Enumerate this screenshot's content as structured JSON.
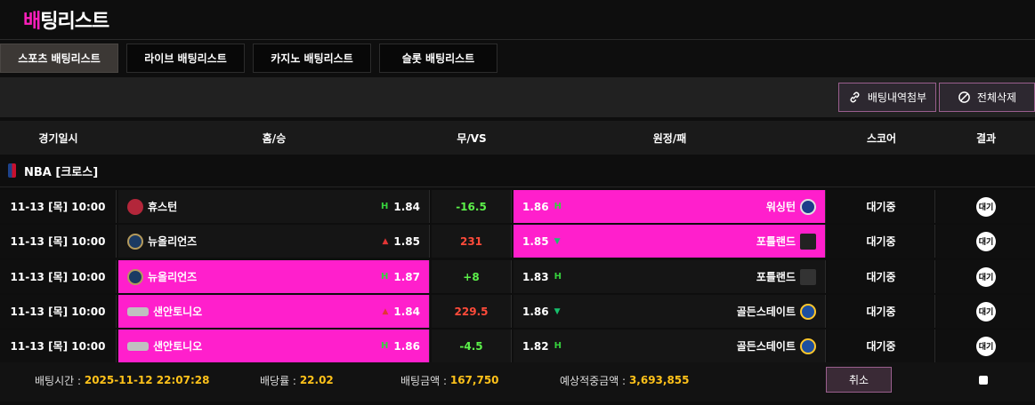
{
  "page": {
    "title_accent": "배",
    "title_rest": "팅리스트"
  },
  "tabs": [
    {
      "label": "스포츠 배팅리스트",
      "active": true
    },
    {
      "label": "라이브 배팅리스트",
      "active": false
    },
    {
      "label": "카지노 배팅리스트",
      "active": false
    },
    {
      "label": "슬롯 배팅리스트",
      "active": false
    }
  ],
  "toolbar": {
    "attach_label": "배팅내역첨부",
    "delete_all_label": "전체삭제"
  },
  "columns": {
    "date": "경기일시",
    "home": "홈/승",
    "draw": "무/VS",
    "away": "원정/패",
    "score": "스코어",
    "result": "결과"
  },
  "league": {
    "name": "NBA [크로스]"
  },
  "rows": [
    {
      "date": "11-13 [목] 10:00",
      "home_team": "휴스턴",
      "home_odds": "1.84",
      "draw": "-16.5",
      "away_team": "워싱턴",
      "away_odds": "1.86",
      "score": "대기중",
      "result": "대기"
    },
    {
      "date": "11-13 [목] 10:00",
      "home_team": "뉴올리언즈",
      "home_odds": "1.85",
      "draw": "231",
      "away_team": "포틀랜드",
      "away_odds": "1.85",
      "score": "대기중",
      "result": "대기"
    },
    {
      "date": "11-13 [목] 10:00",
      "home_team": "뉴올리언즈",
      "home_odds": "1.87",
      "draw": "+8",
      "away_team": "포틀랜드",
      "away_odds": "1.83",
      "score": "대기중",
      "result": "대기"
    },
    {
      "date": "11-13 [목] 10:00",
      "home_team": "샌안토니오",
      "home_odds": "1.84",
      "draw": "229.5",
      "away_team": "골든스테이트",
      "away_odds": "1.86",
      "score": "대기중",
      "result": "대기"
    },
    {
      "date": "11-13 [목] 10:00",
      "home_team": "샌안토니오",
      "home_odds": "1.86",
      "draw": "-4.5",
      "away_team": "골든스테이트",
      "away_odds": "1.82",
      "score": "대기중",
      "result": "대기"
    }
  ],
  "footer": {
    "bet_time_label": "배팅시간 :",
    "bet_time": "2025-11-12 22:07:28",
    "odds_label": "배당률 :",
    "odds": "22.02",
    "amount_label": "배팅금액 :",
    "amount": "167,750",
    "expected_label": "예상적중금액 :",
    "expected": "3,693,855",
    "cancel_label": "취소"
  },
  "colors": {
    "accent": "#ff1fcc",
    "positive": "#5cf04a",
    "negative": "#ff4b3a",
    "highlight_value": "#ffc21a"
  }
}
